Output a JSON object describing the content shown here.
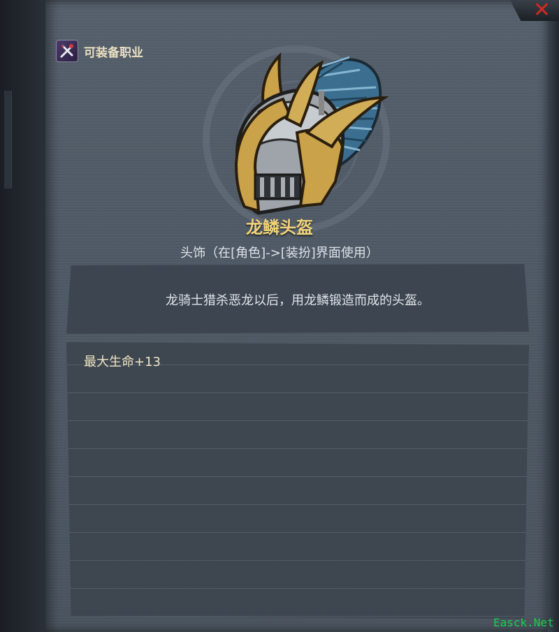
{
  "header": {
    "job_label": "可装备职业"
  },
  "item": {
    "name": "龙鳞头盔",
    "type": "头饰（在[角色]->[装扮]界面使用）",
    "description": "龙骑士猎杀恶龙以后，用龙鳞锻造而成的头盔。",
    "stats": [
      "最大生命+13"
    ]
  },
  "close_label": "✕",
  "watermark": "Easck.Net",
  "icons": {
    "job": "crossed-tools-icon",
    "item": "helmet-icon",
    "close": "close-icon"
  },
  "colors": {
    "panel": "#55606c",
    "item_name": "#f1d27a",
    "close": "#d02a22",
    "watermark": "#14d24a"
  }
}
